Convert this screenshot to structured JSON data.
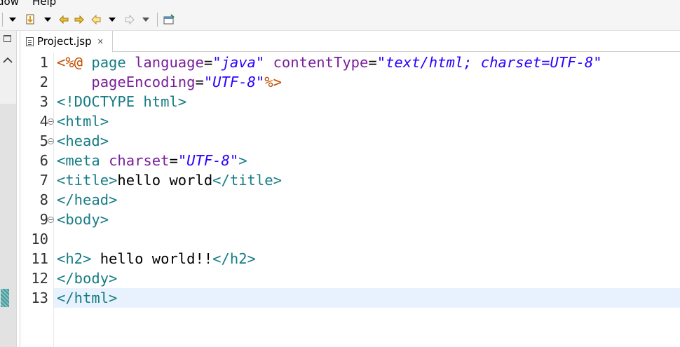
{
  "menubar": {
    "items": [
      {
        "label": "dow"
      },
      {
        "label": "Help"
      }
    ]
  },
  "toolbar": {
    "buttons": [
      "dropdown-arrow-icon",
      "next-annotation-icon",
      "dropdown-arrow-icon",
      "last-edit-icon",
      "nav-forward-history-icon",
      "back-icon",
      "dropdown-arrow-icon",
      "forward-icon",
      "dropdown-arrow-icon",
      "pin-editor-icon"
    ]
  },
  "editor": {
    "tab": {
      "label": "Project.jsp",
      "close": "✕"
    },
    "lines": [
      {
        "n": "1",
        "fold": false,
        "tokens": [
          {
            "c": "jsp",
            "t": "<%@"
          },
          {
            "c": "text",
            "t": " "
          },
          {
            "c": "tag",
            "t": "page"
          },
          {
            "c": "text",
            "t": " "
          },
          {
            "c": "attr",
            "t": "language"
          },
          {
            "c": "eq",
            "t": "="
          },
          {
            "c": "str",
            "t": "\"java\""
          },
          {
            "c": "text",
            "t": " "
          },
          {
            "c": "attr",
            "t": "contentType"
          },
          {
            "c": "eq",
            "t": "="
          },
          {
            "c": "str",
            "t": "\"text/html; charset=UTF-8\""
          }
        ]
      },
      {
        "n": "2",
        "fold": false,
        "tokens": [
          {
            "c": "text",
            "t": "    "
          },
          {
            "c": "attr",
            "t": "pageEncoding"
          },
          {
            "c": "eq",
            "t": "="
          },
          {
            "c": "str",
            "t": "\"UTF-8\""
          },
          {
            "c": "jsp",
            "t": "%>"
          }
        ]
      },
      {
        "n": "3",
        "fold": false,
        "tokens": [
          {
            "c": "tag",
            "t": "<!DOCTYPE html>"
          }
        ]
      },
      {
        "n": "4",
        "fold": true,
        "tokens": [
          {
            "c": "tag",
            "t": "<html>"
          }
        ]
      },
      {
        "n": "5",
        "fold": true,
        "tokens": [
          {
            "c": "tag",
            "t": "<head>"
          }
        ]
      },
      {
        "n": "6",
        "fold": false,
        "tokens": [
          {
            "c": "tag",
            "t": "<meta"
          },
          {
            "c": "text",
            "t": " "
          },
          {
            "c": "attr",
            "t": "charset"
          },
          {
            "c": "eq",
            "t": "="
          },
          {
            "c": "str",
            "t": "\"UTF-8\""
          },
          {
            "c": "tag",
            "t": ">"
          }
        ]
      },
      {
        "n": "7",
        "fold": false,
        "tokens": [
          {
            "c": "tag",
            "t": "<title>"
          },
          {
            "c": "text",
            "t": "hello world"
          },
          {
            "c": "tag",
            "t": "</title>"
          }
        ]
      },
      {
        "n": "8",
        "fold": false,
        "tokens": [
          {
            "c": "tag",
            "t": "</head>"
          }
        ]
      },
      {
        "n": "9",
        "fold": true,
        "tokens": [
          {
            "c": "tag",
            "t": "<body>"
          }
        ]
      },
      {
        "n": "10",
        "fold": false,
        "tokens": []
      },
      {
        "n": "11",
        "fold": false,
        "tokens": [
          {
            "c": "tag",
            "t": "<h2>"
          },
          {
            "c": "text",
            "t": " hello world!!"
          },
          {
            "c": "tag",
            "t": "</h2>"
          }
        ]
      },
      {
        "n": "12",
        "fold": false,
        "tokens": [
          {
            "c": "tag",
            "t": "</body>"
          }
        ]
      },
      {
        "n": "13",
        "fold": false,
        "current": true,
        "tokens": [
          {
            "c": "tag",
            "t": "</html>"
          }
        ]
      }
    ]
  },
  "colors": {
    "tag": "#157c85",
    "jsp": "#c04d00",
    "attr": "#7a1e9a",
    "string": "#2a00ff",
    "current_line": "#e8f2fe"
  }
}
